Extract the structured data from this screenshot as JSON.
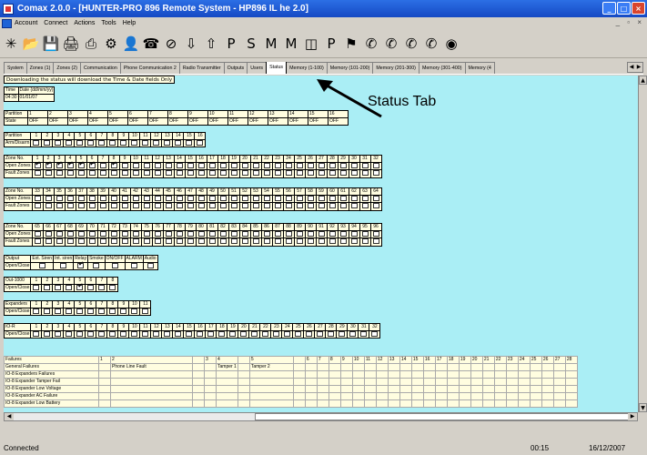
{
  "window": {
    "title": "Comax   2.0.0 - [HUNTER-PRO 896  Remote System - HP896 IL he 2.0]"
  },
  "menu": [
    "Account",
    "Connect",
    "Actions",
    "Tools",
    "Help"
  ],
  "toolbar": [
    "new-icon",
    "open-icon",
    "save-icon",
    "print-icon",
    "print-preview-icon",
    "settings-icon",
    "user-icon",
    "phone-icon",
    "stop-icon",
    "download-icon",
    "upload-icon",
    "program-p-icon",
    "program-s-icon",
    "program-m-icon",
    "program-m2-icon",
    "remote-icon",
    "program-ps-icon",
    "flag-icon",
    "phone-dial-1-icon",
    "phone-dial-2-icon",
    "phone-dial-3-icon",
    "phone-dial-4-icon",
    "globe-icon"
  ],
  "tabs": [
    "System",
    "Zones (1)",
    "Zones (2)",
    "Communication",
    "Phone Communication 2",
    "Radio Transmitter",
    "Outputs",
    "Users",
    "Status",
    "Memory (1-100)",
    "Memory (101-200)",
    "Memory (201-300)",
    "Memory (301-400)",
    "Memory (4"
  ],
  "active_tab": "Status",
  "note": "Downloading the status will download the Time & Date fields Only",
  "time": {
    "h1": "Time",
    "h2": "Date (dd/mm/yy)",
    "time": "04:30",
    "date": "01/01/07"
  },
  "partition_state": {
    "label1": "Partition",
    "label2": "State",
    "cols": [
      "1",
      "2",
      "3",
      "4",
      "5",
      "6",
      "7",
      "8",
      "9",
      "10",
      "11",
      "12",
      "13",
      "14",
      "15",
      "16"
    ],
    "value": "OFF"
  },
  "partition_arm": {
    "label1": "Partition",
    "label2": "Arm/Disarm",
    "cols": [
      "1",
      "2",
      "3",
      "4",
      "5",
      "6",
      "7",
      "8",
      "9",
      "10",
      "11",
      "12",
      "13",
      "14",
      "15",
      "16"
    ]
  },
  "zones": [
    {
      "start": 1,
      "checked": [
        1,
        2,
        3,
        4,
        5,
        6,
        8
      ]
    },
    {
      "start": 33,
      "checked": []
    },
    {
      "start": 65,
      "checked": []
    }
  ],
  "zone_labels": {
    "no": "Zone No.",
    "open": "Open Zones",
    "fault": "Fault Zones"
  },
  "output": {
    "label1": "Output",
    "label2": "Open/Close",
    "cols": [
      "Ext. Siren",
      "Int. siren",
      "Relay",
      "Smoke",
      "ON/OFF",
      "ALARM",
      "Audio"
    ],
    "checked": [
      3
    ]
  },
  "out1000": {
    "label1": "Out-1000",
    "label2": "Open/Close",
    "cols": [
      "1",
      "2",
      "3",
      "4",
      "5",
      "6",
      "7",
      "8"
    ],
    "checked": [
      5
    ]
  },
  "expanders": {
    "label1": "Expanders",
    "label2": "Open/Close",
    "cols": [
      "1",
      "2",
      "3",
      "4",
      "5",
      "6",
      "7",
      "8",
      "9",
      "10",
      "11"
    ]
  },
  "io8": {
    "label1": "IO-R",
    "label2": "Open/Close"
  },
  "failures": {
    "header": [
      "Failures",
      "1",
      "2",
      "",
      "3",
      "4",
      "",
      "5",
      "",
      "6",
      "7",
      "8",
      "9",
      "10",
      "11",
      "12",
      "13",
      "14",
      "15",
      "16",
      "17",
      "18",
      "19",
      "20",
      "21",
      "22",
      "23",
      "24",
      "25",
      "26",
      "27",
      "28"
    ],
    "rows": [
      [
        "General Failures",
        "",
        "Phone Line Fault",
        "",
        "",
        "Tamper 1",
        "",
        "Tamper 2"
      ],
      [
        "IO-8 Expanders Failures"
      ],
      [
        "IO-8 Expander Tamper Fail"
      ],
      [
        "IO-8 Expander Low Voltage"
      ],
      [
        "IO-8 Expander AC Failure"
      ],
      [
        "IO-8 Expander Low Battery"
      ]
    ]
  },
  "annotation": "Status Tab",
  "status": {
    "left": "Connected",
    "time": "00:15",
    "date": "16/12/2007"
  }
}
